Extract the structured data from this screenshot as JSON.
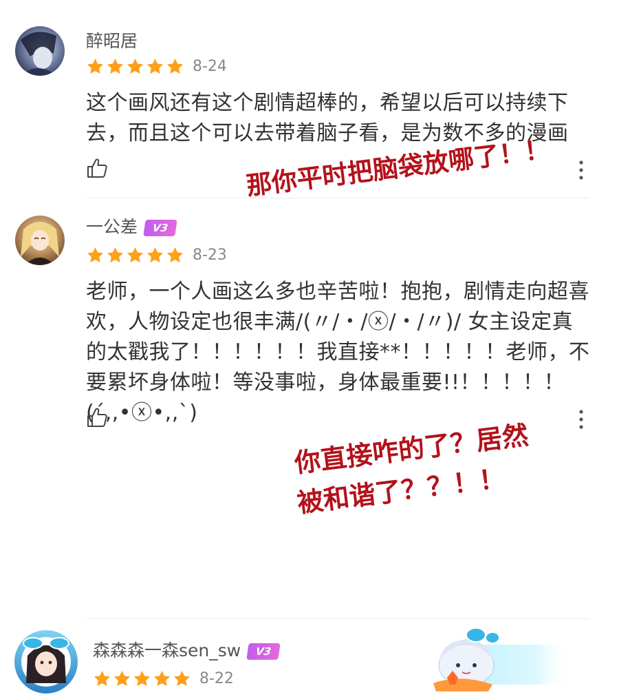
{
  "comments": [
    {
      "username": "醉昭居",
      "date": "8-24",
      "stars": 5,
      "badge": "",
      "text": "这个画风还有这个剧情超棒的，希望以后可以持续下去，而且这个可以去带着脑子看，是为数不多的漫画"
    },
    {
      "username": "一公差",
      "date": "8-23",
      "stars": 5,
      "badge": "V3",
      "text": "老师，一个人画这么多也辛苦啦！抱抱，剧情走向超喜欢，人物设定也很丰满/(〃/・/ⓧ/・/〃)/ 女主设定真的太戳我了！！！！！！我直接**！！！！！老师，不要累坏身体啦！等没事啦，身体最重要!!！！！！！(´,,•ⓧ•,,`)"
    },
    {
      "username": "森森森一森sen_sw",
      "date": "8-22",
      "stars": 5,
      "badge": "V3"
    }
  ],
  "annotations": {
    "first": "那你平时把脑袋放哪了！！",
    "second_line1": "你直接咋的了？居然",
    "second_line2": "被和谐了？？！！"
  },
  "colors": {
    "star": "#ff9f1a",
    "annotation": "#b3121b",
    "badge": "#c95fee"
  },
  "icons": [
    "like-icon",
    "more-icon",
    "star-icon",
    "avatar"
  ]
}
